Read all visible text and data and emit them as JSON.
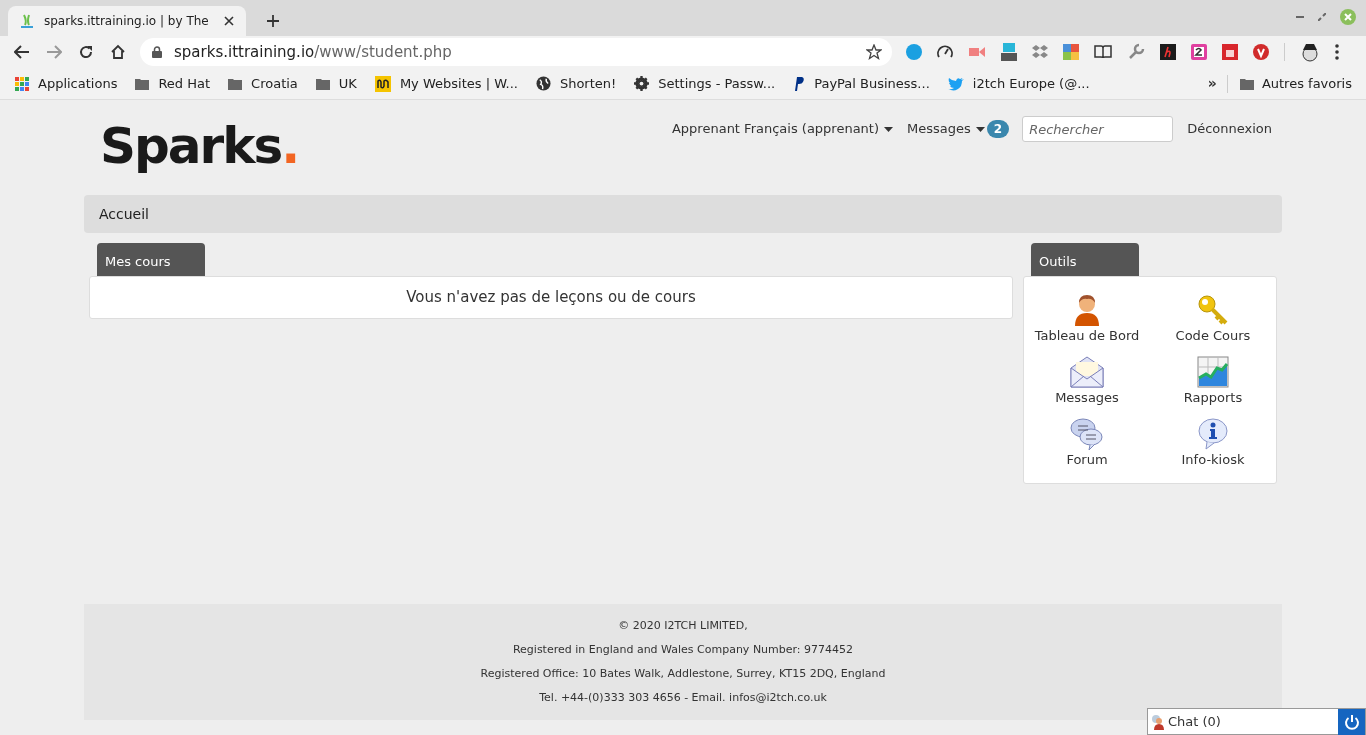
{
  "browser": {
    "tab_title": "sparks.ittraining.io | by The",
    "url_host": "sparks.ittraining.io",
    "url_path": "/www/student.php",
    "bookmarks": [
      {
        "kind": "apps",
        "label": "Applications"
      },
      {
        "kind": "folder",
        "label": "Red Hat"
      },
      {
        "kind": "folder",
        "label": "Croatia"
      },
      {
        "kind": "folder",
        "label": "UK"
      },
      {
        "kind": "site",
        "label": "My Websites | W..."
      },
      {
        "kind": "globe",
        "label": "Shorten!"
      },
      {
        "kind": "gear",
        "label": "Settings - Passw..."
      },
      {
        "kind": "paypal",
        "label": "PayPal Business..."
      },
      {
        "kind": "twitter",
        "label": "i2tch Europe (@..."
      }
    ],
    "overflow": "»",
    "other_bookmarks": "Autres favoris"
  },
  "header": {
    "logo": "Sparks",
    "logo_dot": ".",
    "user_menu": "Apprenant Français (apprenant)",
    "messages": "Messages",
    "messages_count": "2",
    "search": {
      "placeholder": "Rechercher"
    },
    "logout": "Déconnexion"
  },
  "breadcrumb": "Accueil",
  "courses": {
    "title": "Mes cours",
    "empty_message": "Vous n'avez pas de leçons ou de cours"
  },
  "tools": {
    "title": "Outils",
    "items": [
      {
        "kind": "person",
        "label": "Tableau de Bord"
      },
      {
        "kind": "key",
        "label": "Code Cours"
      },
      {
        "kind": "envelope",
        "label": "Messages"
      },
      {
        "kind": "chart",
        "label": "Rapports"
      },
      {
        "kind": "bubbles",
        "label": "Forum"
      },
      {
        "kind": "info",
        "label": "Info-kiosk"
      }
    ]
  },
  "footer": [
    "© 2020 I2TCH LIMITED,",
    "Registered in England and Wales Company Number: 9774452",
    "Registered Office: 10 Bates Walk, Addlestone, Surrey, KT15 2DQ, England",
    "Tel. +44-(0)333 303 4656 - Email. infos@i2tch.co.uk"
  ],
  "chat": {
    "label": "Chat (0)"
  }
}
